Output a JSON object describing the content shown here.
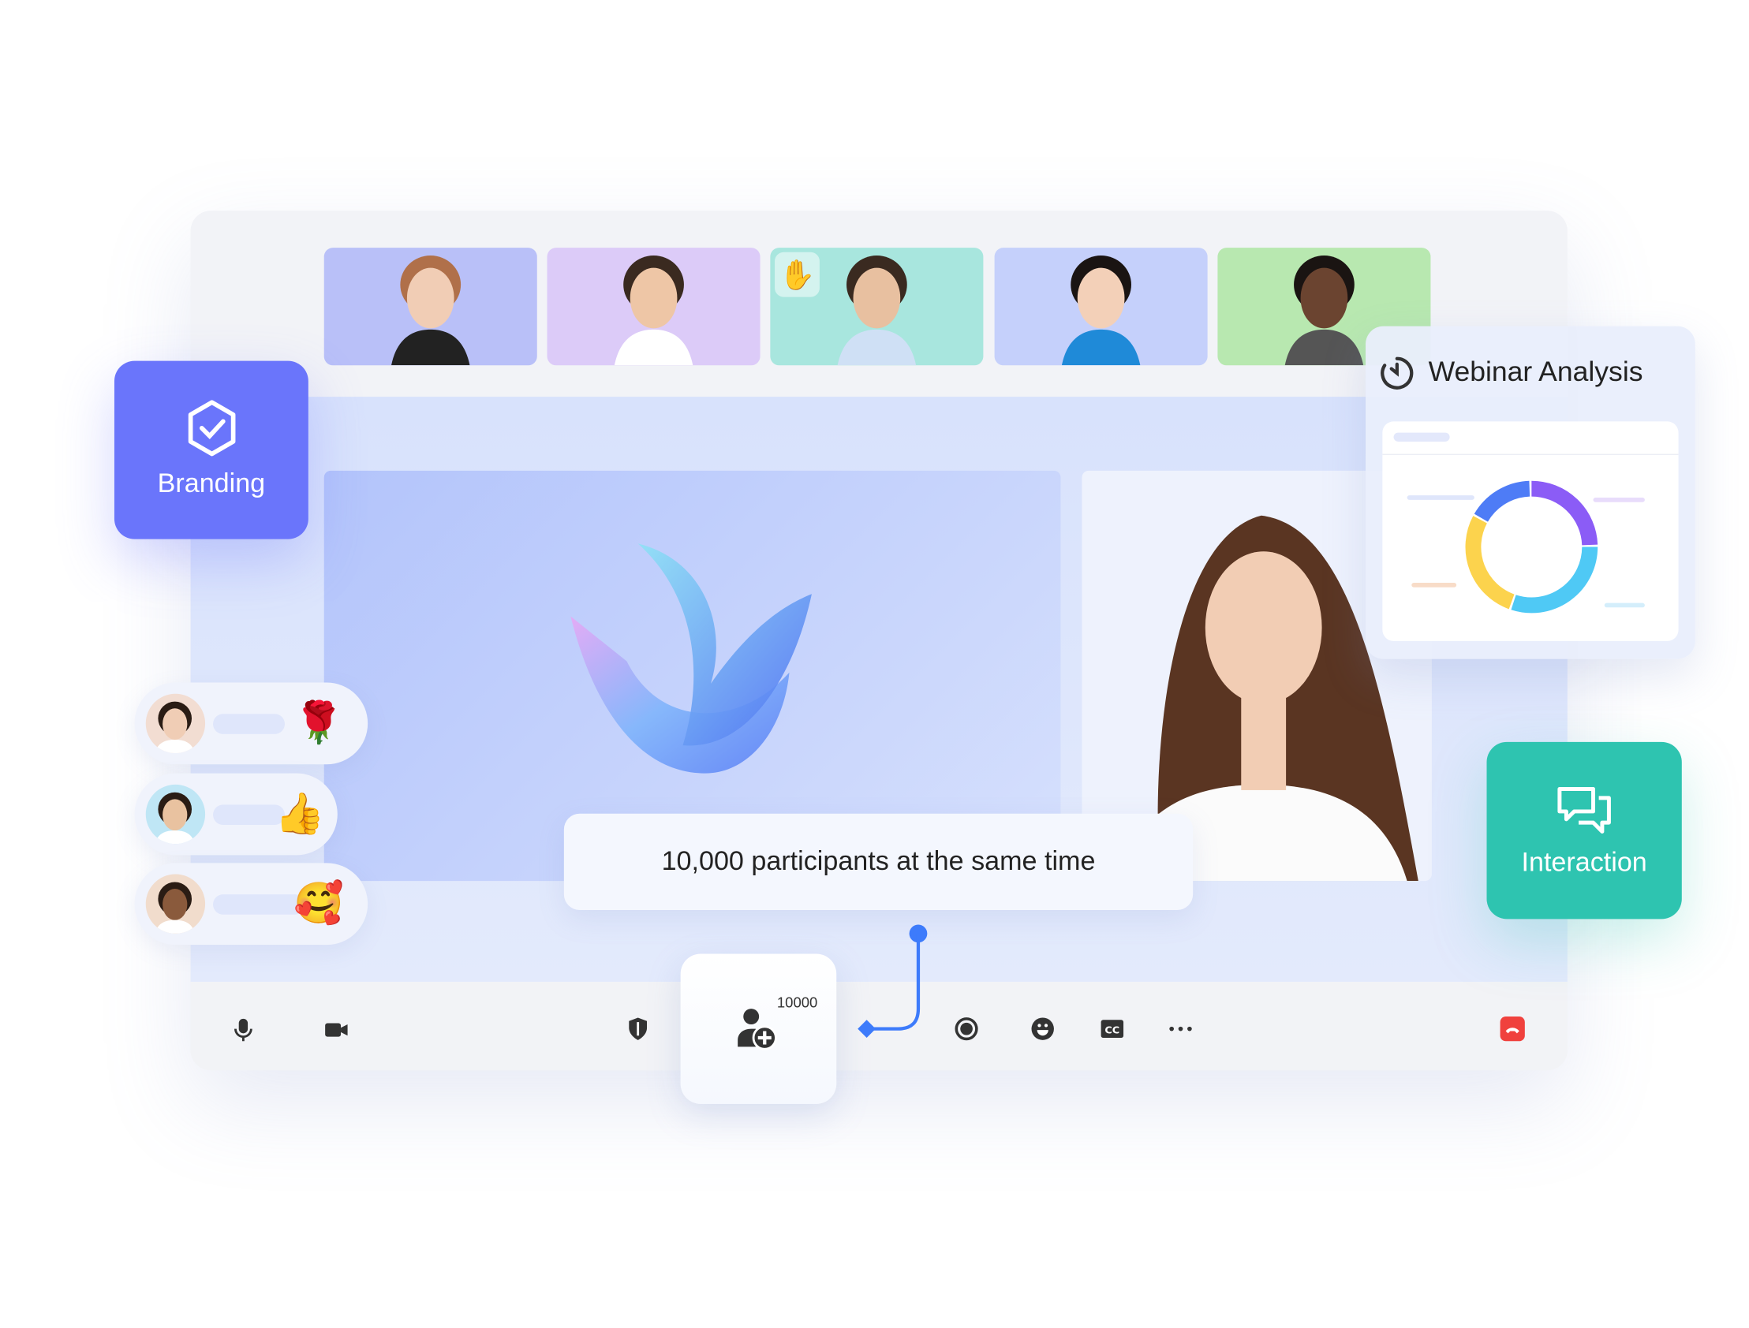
{
  "participants": [
    {
      "name": "participant-1",
      "bg": "#b9c0f8"
    },
    {
      "name": "participant-2",
      "bg": "#dccbf8"
    },
    {
      "name": "participant-3",
      "bg": "#a8e6de",
      "raised_hand": true
    },
    {
      "name": "participant-4",
      "bg": "#c5d0fb"
    },
    {
      "name": "participant-5",
      "bg": "#b8e8b0"
    }
  ],
  "caption": "10,000 participants at the same time",
  "participant_count": "10000",
  "branding": {
    "label": "Branding",
    "icon": "hexagon-check-icon",
    "color": "#6a75fb"
  },
  "interaction": {
    "label": "Interaction",
    "icon": "chat-bubbles-icon",
    "color": "#2ec4b0"
  },
  "analysis": {
    "title": "Webinar Analysis",
    "icon": "timer-icon",
    "donut_colors": [
      "#8b5cf6",
      "#4fc9f5",
      "#fcd34d",
      "#4e7cf6"
    ]
  },
  "reactions": [
    {
      "emoji": "🌹",
      "label": "flower-reaction"
    },
    {
      "emoji": "👍",
      "label": "thumbs-up-reaction"
    },
    {
      "emoji": "🥰",
      "label": "love-reaction"
    }
  ],
  "toolbar": {
    "icons": [
      "mic-icon",
      "camera-icon",
      "shield-icon",
      "record-icon",
      "emoji-icon",
      "cc-icon",
      "more-icon",
      "end-call-icon"
    ],
    "end_call_color": "#f0413d",
    "accent": "#3d7bfb"
  }
}
